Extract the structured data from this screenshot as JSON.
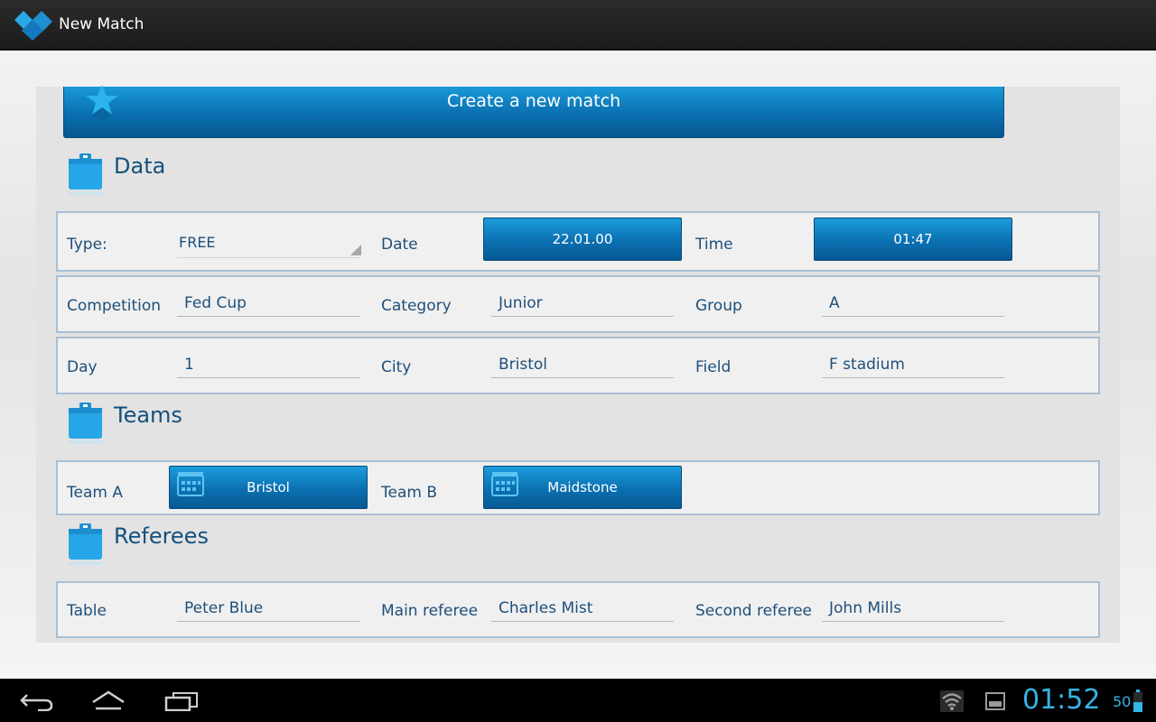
{
  "app": {
    "title": "New Match"
  },
  "create_button": {
    "label": "Create a new match"
  },
  "sections": {
    "data": "Data",
    "teams": "Teams",
    "referees": "Referees"
  },
  "match": {
    "type_label": "Type:",
    "type_value": "FREE",
    "date_label": "Date",
    "date_value": "22.01.00",
    "time_label": "Time",
    "time_value": "01:47",
    "competition_label": "Competition",
    "competition_value": "Fed Cup",
    "category_label": "Category",
    "category_value": "Junior",
    "group_label": "Group",
    "group_value": "A",
    "day_label": "Day",
    "day_value": "1",
    "city_label": "City",
    "city_value": "Bristol",
    "field_label": "Field",
    "field_value": "F stadium"
  },
  "teams": {
    "team_a_label": "Team A",
    "team_a_value": "Bristol",
    "team_b_label": "Team B",
    "team_b_value": "Maidstone"
  },
  "referees": {
    "table_label": "Table",
    "table_value": "Peter Blue",
    "main_label": "Main referee",
    "main_value": "Charles Mist",
    "second_label": "Second referee",
    "second_value": "John Mills"
  },
  "system_bar": {
    "clock": "01:52",
    "battery": "50"
  },
  "colors": {
    "accent": "#0a6fb0",
    "text": "#1e4f7a",
    "clock": "#33b5e5"
  }
}
